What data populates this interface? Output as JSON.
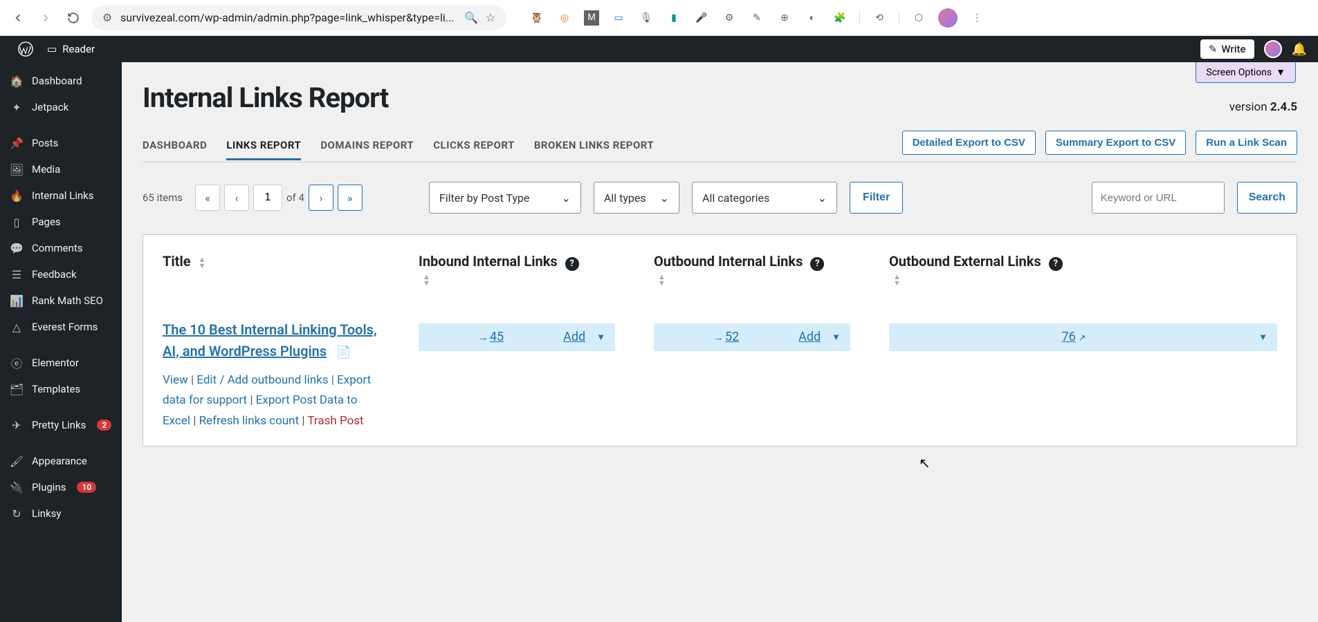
{
  "browser": {
    "url": "survivezeal.com/wp-admin/admin.php?page=link_whisper&type=li..."
  },
  "wpbar": {
    "reader": "Reader",
    "write": "Write"
  },
  "sidebar": {
    "items": [
      {
        "label": "Dashboard",
        "icon": "📊"
      },
      {
        "label": "Jetpack",
        "icon": "✦"
      },
      {
        "label": "Posts",
        "icon": "📌"
      },
      {
        "label": "Media",
        "icon": "🖼"
      },
      {
        "label": "Internal Links",
        "icon": "🔥"
      },
      {
        "label": "Pages",
        "icon": "📄"
      },
      {
        "label": "Comments",
        "icon": "💬"
      },
      {
        "label": "Feedback",
        "icon": "☰"
      },
      {
        "label": "Rank Math SEO",
        "icon": "📈"
      },
      {
        "label": "Everest Forms",
        "icon": "△"
      },
      {
        "label": "Elementor",
        "icon": "ⓔ"
      },
      {
        "label": "Templates",
        "icon": "🗂"
      },
      {
        "label": "Pretty Links",
        "icon": "✈",
        "badge": "2"
      },
      {
        "label": "Appearance",
        "icon": "🖌"
      },
      {
        "label": "Plugins",
        "icon": "🔌",
        "badge": "10"
      },
      {
        "label": "Linksy",
        "icon": "↻"
      }
    ]
  },
  "screen_options": "Screen Options",
  "page": {
    "title": "Internal Links Report",
    "version_label": "version ",
    "version": "2.4.5"
  },
  "tabs": {
    "items": [
      "DASHBOARD",
      "LINKS REPORT",
      "DOMAINS REPORT",
      "CLICKS REPORT",
      "BROKEN LINKS REPORT"
    ],
    "buttons": [
      "Detailed Export to CSV",
      "Summary Export to CSV",
      "Run a Link Scan"
    ]
  },
  "filters": {
    "items_count": "65 items",
    "page_current": "1",
    "page_of": "of 4",
    "post_type": "Filter by Post Type",
    "all_types": "All types",
    "all_categories": "All categories",
    "filter_btn": "Filter",
    "search_placeholder": "Keyword or URL",
    "search_btn": "Search"
  },
  "table": {
    "headers": {
      "title": "Title",
      "inbound": "Inbound Internal Links",
      "outbound_int": "Outbound Internal Links",
      "outbound_ext": "Outbound External Links"
    },
    "row": {
      "title": "The 10 Best Internal Linking Tools, AI, and WordPress Plugins",
      "actions": {
        "view": "View",
        "edit": "Edit / Add outbound links",
        "export_support": "Export data for support",
        "export_excel": "Export Post Data to Excel",
        "refresh": "Refresh links count",
        "trash": "Trash Post"
      },
      "inbound": "45",
      "outbound_int": "52",
      "outbound_ext": "76",
      "add_label": "Add"
    }
  }
}
